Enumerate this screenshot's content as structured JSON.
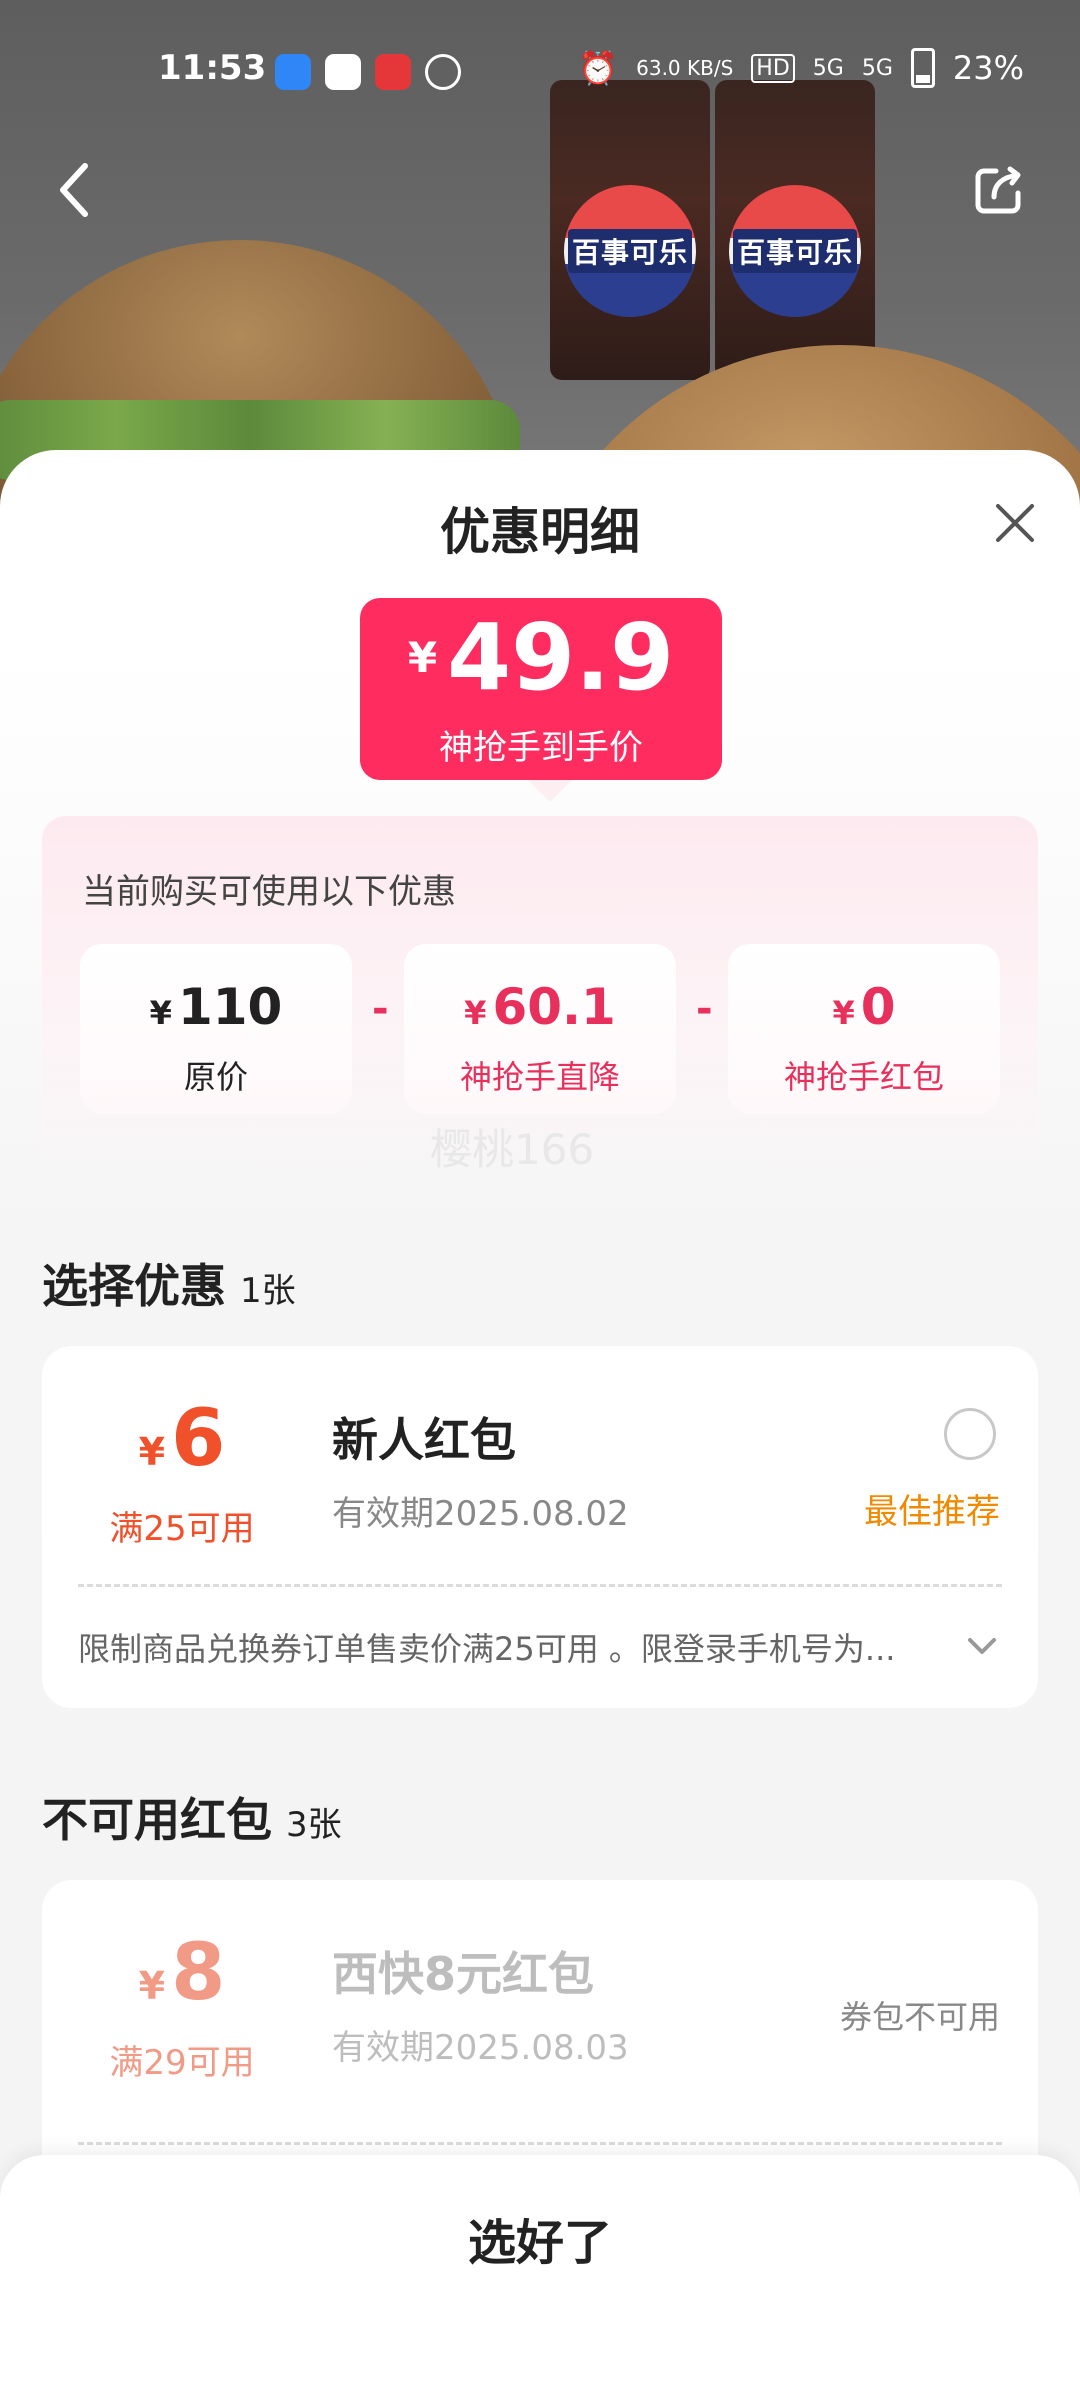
{
  "status_bar": {
    "time": "11:53",
    "net_speed": "63.0 KB/S",
    "battery": "23%",
    "signal_1": "5G",
    "signal_2": "5G",
    "hd_label": "HD"
  },
  "hero": {
    "cup_logo_text": "百事可乐"
  },
  "sheet": {
    "title": "优惠明细",
    "price": {
      "symbol": "¥",
      "amount": "49.9",
      "caption": "神抢手到手价"
    },
    "breakdown": {
      "label": "当前购买可使用以下优惠",
      "items": [
        {
          "symbol": "¥",
          "value": "110",
          "label": "原价"
        },
        {
          "symbol": "¥",
          "value": "60.1",
          "label": "神抢手直降"
        },
        {
          "symbol": "¥",
          "value": "0",
          "label": "神抢手红包"
        }
      ],
      "operator": "-"
    },
    "watermark": "樱桃166",
    "select_section": {
      "title": "选择优惠",
      "count": "1张",
      "coupons": [
        {
          "symbol": "¥",
          "amount": "6",
          "condition": "满25可用",
          "name": "新人红包",
          "expiry": "有效期2025.08.02",
          "tag": "最佳推荐",
          "description": "限制商品兑换券订单售卖价满25可用 。限登录手机号为..."
        }
      ]
    },
    "unavailable_section": {
      "title": "不可用红包",
      "count": "3张",
      "coupons": [
        {
          "symbol": "¥",
          "amount": "8",
          "condition": "满29可用",
          "name": "西快8元红包",
          "expiry": "有效期2025.08.03",
          "status": "券包不可用"
        }
      ]
    },
    "confirm_button": "选好了"
  },
  "colors": {
    "accent": "#ff2d5f",
    "coupon_amount": "#f0502a",
    "best_tag": "#f08a00"
  }
}
